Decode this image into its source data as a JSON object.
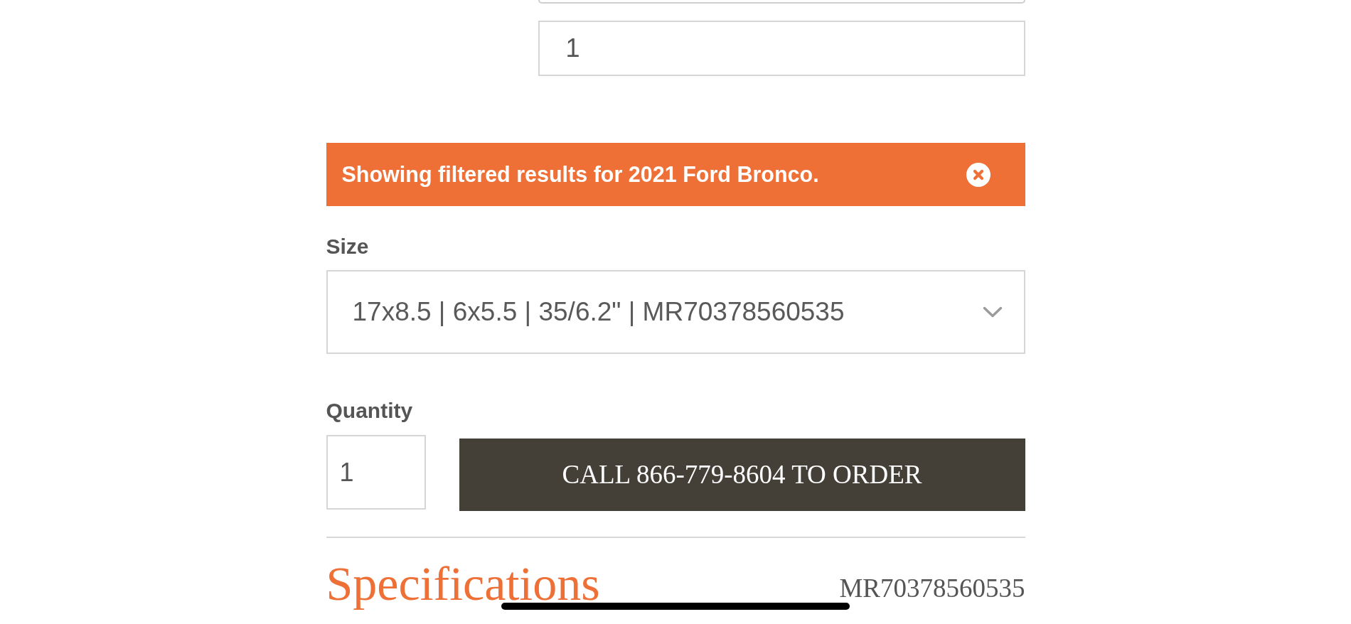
{
  "vehicle_form": {
    "fields": [
      {
        "kind": "select"
      },
      {
        "kind": "input",
        "value": "1"
      }
    ]
  },
  "filter_banner": {
    "message": "Showing filtered results for 2021 Ford Bronco.",
    "dismissible": true
  },
  "size": {
    "label": "Size",
    "value": "17x8.5 | 6x5.5 | 35/6.2\" | MR70378560535"
  },
  "quantity": {
    "label": "Quantity",
    "value": "1"
  },
  "order_button": {
    "label": "CALL 866-779-8604 TO ORDER"
  },
  "specifications": {
    "title": "Specifications",
    "part_number": "MR70378560535"
  }
}
